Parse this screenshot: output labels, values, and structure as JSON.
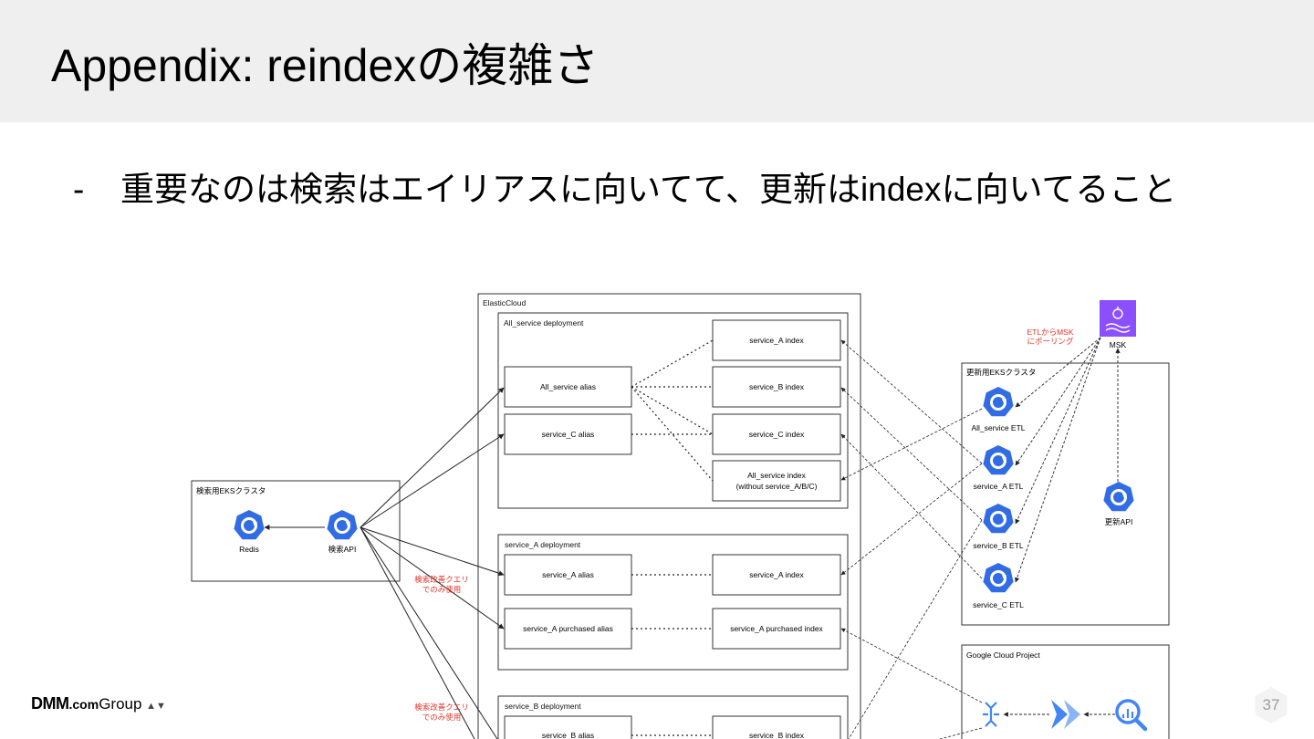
{
  "slide": {
    "title": "Appendix: reindexの複雑さ",
    "bullet_dash": "-",
    "bullet": "重要なのは検索はエイリアスに向いてて、更新はindexに向いてること",
    "page_number": "37"
  },
  "footer": {
    "logo_dmm": "DMM",
    "logo_com": ".com",
    "logo_group": "Group",
    "logo_mark": "▲▼"
  },
  "colors": {
    "accent_red": "#e0352b",
    "kube_blue": "#326ce5",
    "msk_purple": "#8c4fff",
    "gcp_blue": "#4285f4"
  },
  "diagram": {
    "elastic_cloud": "ElasticCloud",
    "all_service_deployment": "All_service deployment",
    "service_a_deployment": "service_A deployment",
    "service_b_deployment": "service_B deployment",
    "all_service_alias": "All_service alias",
    "service_c_alias": "service_C alias",
    "service_a_index_all": "service_A index",
    "service_b_index_all": "service_B index",
    "service_c_index_all": "service_C index",
    "all_service_index_line1": "All_service index",
    "all_service_index_line2": "(without service_A/B/C)",
    "service_a_alias": "service_A alias",
    "service_a_purchased_alias": "service_A purchased alias",
    "service_a_index": "service_A index",
    "service_a_purchased_index": "service_A purchased index",
    "service_b_alias": "service_B alias",
    "service_b_index": "service_B index",
    "search_cluster": "検索用EKSクラスタ",
    "redis": "Redis",
    "search_api": "検索API",
    "note_improve_1_line1": "検索改善クエリ",
    "note_improve_1_line2": "でのみ使用",
    "note_improve_2_line1": "検索改善クエリ",
    "note_improve_2_line2": "でのみ使用",
    "update_cluster": "更新用EKSクラスタ",
    "all_service_etl": "All_service ETL",
    "service_a_etl": "service_A ETL",
    "service_b_etl": "service_B ETL",
    "service_c_etl": "service_C ETL",
    "update_api": "更新API",
    "msk": "MSK",
    "msk_note_line1": "ETLからMSK",
    "msk_note_line2": "にポーリング",
    "gcp_project": "Google Cloud Project"
  },
  "icons": [
    "kubernetes-icon",
    "msk-icon",
    "dataflow-icon",
    "pubsub-icon",
    "bigquery-icon"
  ]
}
